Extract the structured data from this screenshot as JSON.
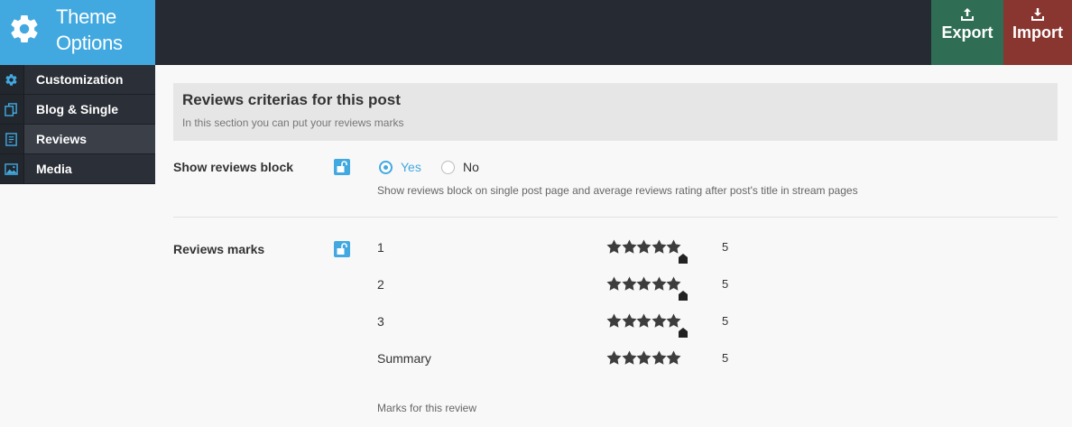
{
  "header": {
    "brand_title": "Theme Options",
    "export_label": "Export",
    "import_label": "Import",
    "colors": {
      "brand": "#42a9e0",
      "export": "#2f6e55",
      "import": "#8a3630"
    }
  },
  "sidebar": {
    "items": [
      {
        "label": "Customization",
        "icon": "gear-icon"
      },
      {
        "label": "Blog & Single",
        "icon": "copy-icon"
      },
      {
        "label": "Reviews",
        "icon": "document-icon",
        "active": true
      },
      {
        "label": "Media",
        "icon": "image-icon"
      }
    ]
  },
  "section": {
    "title": "Reviews criterias for this post",
    "description": "In this section you can put your reviews marks"
  },
  "show_reviews": {
    "label": "Show reviews block",
    "options": [
      "Yes",
      "No"
    ],
    "selected": "Yes",
    "help": "Show reviews block on single post page and average reviews rating after post's title in stream pages"
  },
  "reviews_marks": {
    "label": "Reviews marks",
    "items": [
      {
        "name": "1",
        "value": "5",
        "rating": 5
      },
      {
        "name": "2",
        "value": "5",
        "rating": 5
      },
      {
        "name": "3",
        "value": "5",
        "rating": 5
      },
      {
        "name": "Summary",
        "value": "5",
        "rating": 5
      }
    ],
    "help": "Marks for this review"
  }
}
